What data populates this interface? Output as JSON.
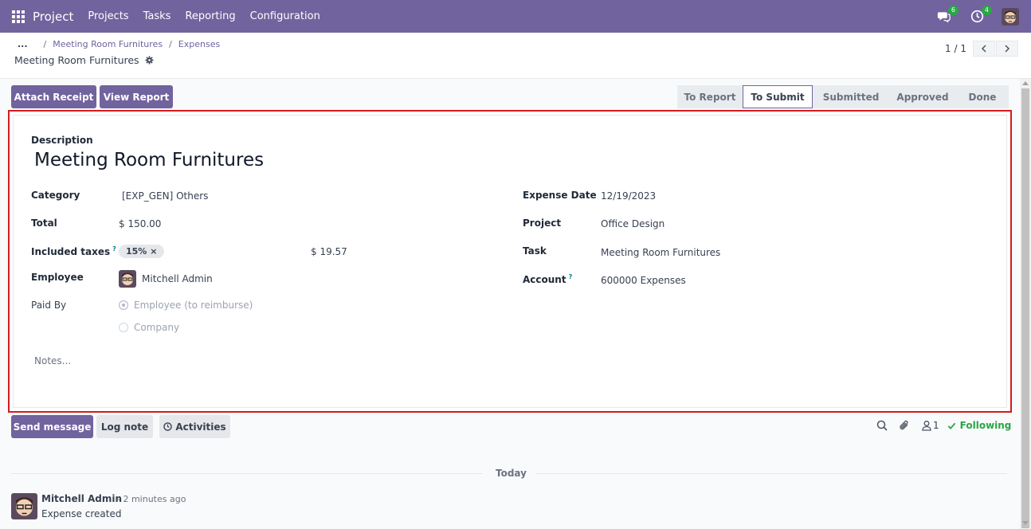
{
  "navbar": {
    "app_name": "Project",
    "menu": [
      "Projects",
      "Tasks",
      "Reporting",
      "Configuration"
    ],
    "messages_badge": "6",
    "activities_badge": "4"
  },
  "breadcrumb": {
    "ellipsis": "...",
    "items": [
      "Meeting Room Furnitures",
      "Expenses"
    ],
    "current": "Meeting Room Furnitures"
  },
  "pager": {
    "value": "1 / 1"
  },
  "actions": {
    "attach_receipt": "Attach Receipt",
    "view_report": "View Report"
  },
  "statusbar": {
    "stages": [
      "To Report",
      "To Submit",
      "Submitted",
      "Approved",
      "Done"
    ],
    "active": "To Submit"
  },
  "form": {
    "description_label": "Description",
    "description": "Meeting Room Furnitures",
    "category_label": "Category",
    "category": "[EXP_GEN] Others",
    "total_label": "Total",
    "total": "$ 150.00",
    "included_taxes_label": "Included taxes",
    "help_mark": "?",
    "tax_tag": "15%",
    "tax_remove": "×",
    "tax_amount": "$ 19.57",
    "employee_label": "Employee",
    "employee": "Mitchell Admin",
    "paid_by_label": "Paid By",
    "paid_by_options": [
      "Employee (to reimburse)",
      "Company"
    ],
    "paid_by_selected": "Employee (to reimburse)",
    "expense_date_label": "Expense Date",
    "expense_date": "12/19/2023",
    "project_label": "Project",
    "project": "Office Design",
    "task_label": "Task",
    "task": "Meeting Room Furnitures",
    "account_label": "Account",
    "account": "600000 Expenses",
    "notes_placeholder": "Notes..."
  },
  "chatter": {
    "send_message": "Send message",
    "log_note": "Log note",
    "activities": "Activities",
    "followers_count": "1",
    "following": "Following",
    "date_separator": "Today",
    "message": {
      "author": "Mitchell Admin",
      "time": "- 2 minutes ago",
      "body": "Expense created"
    }
  },
  "colors": {
    "navbar": "#71639e",
    "primary": "#71639e",
    "highlight_border": "#d21c1c",
    "following": "#28a745"
  }
}
